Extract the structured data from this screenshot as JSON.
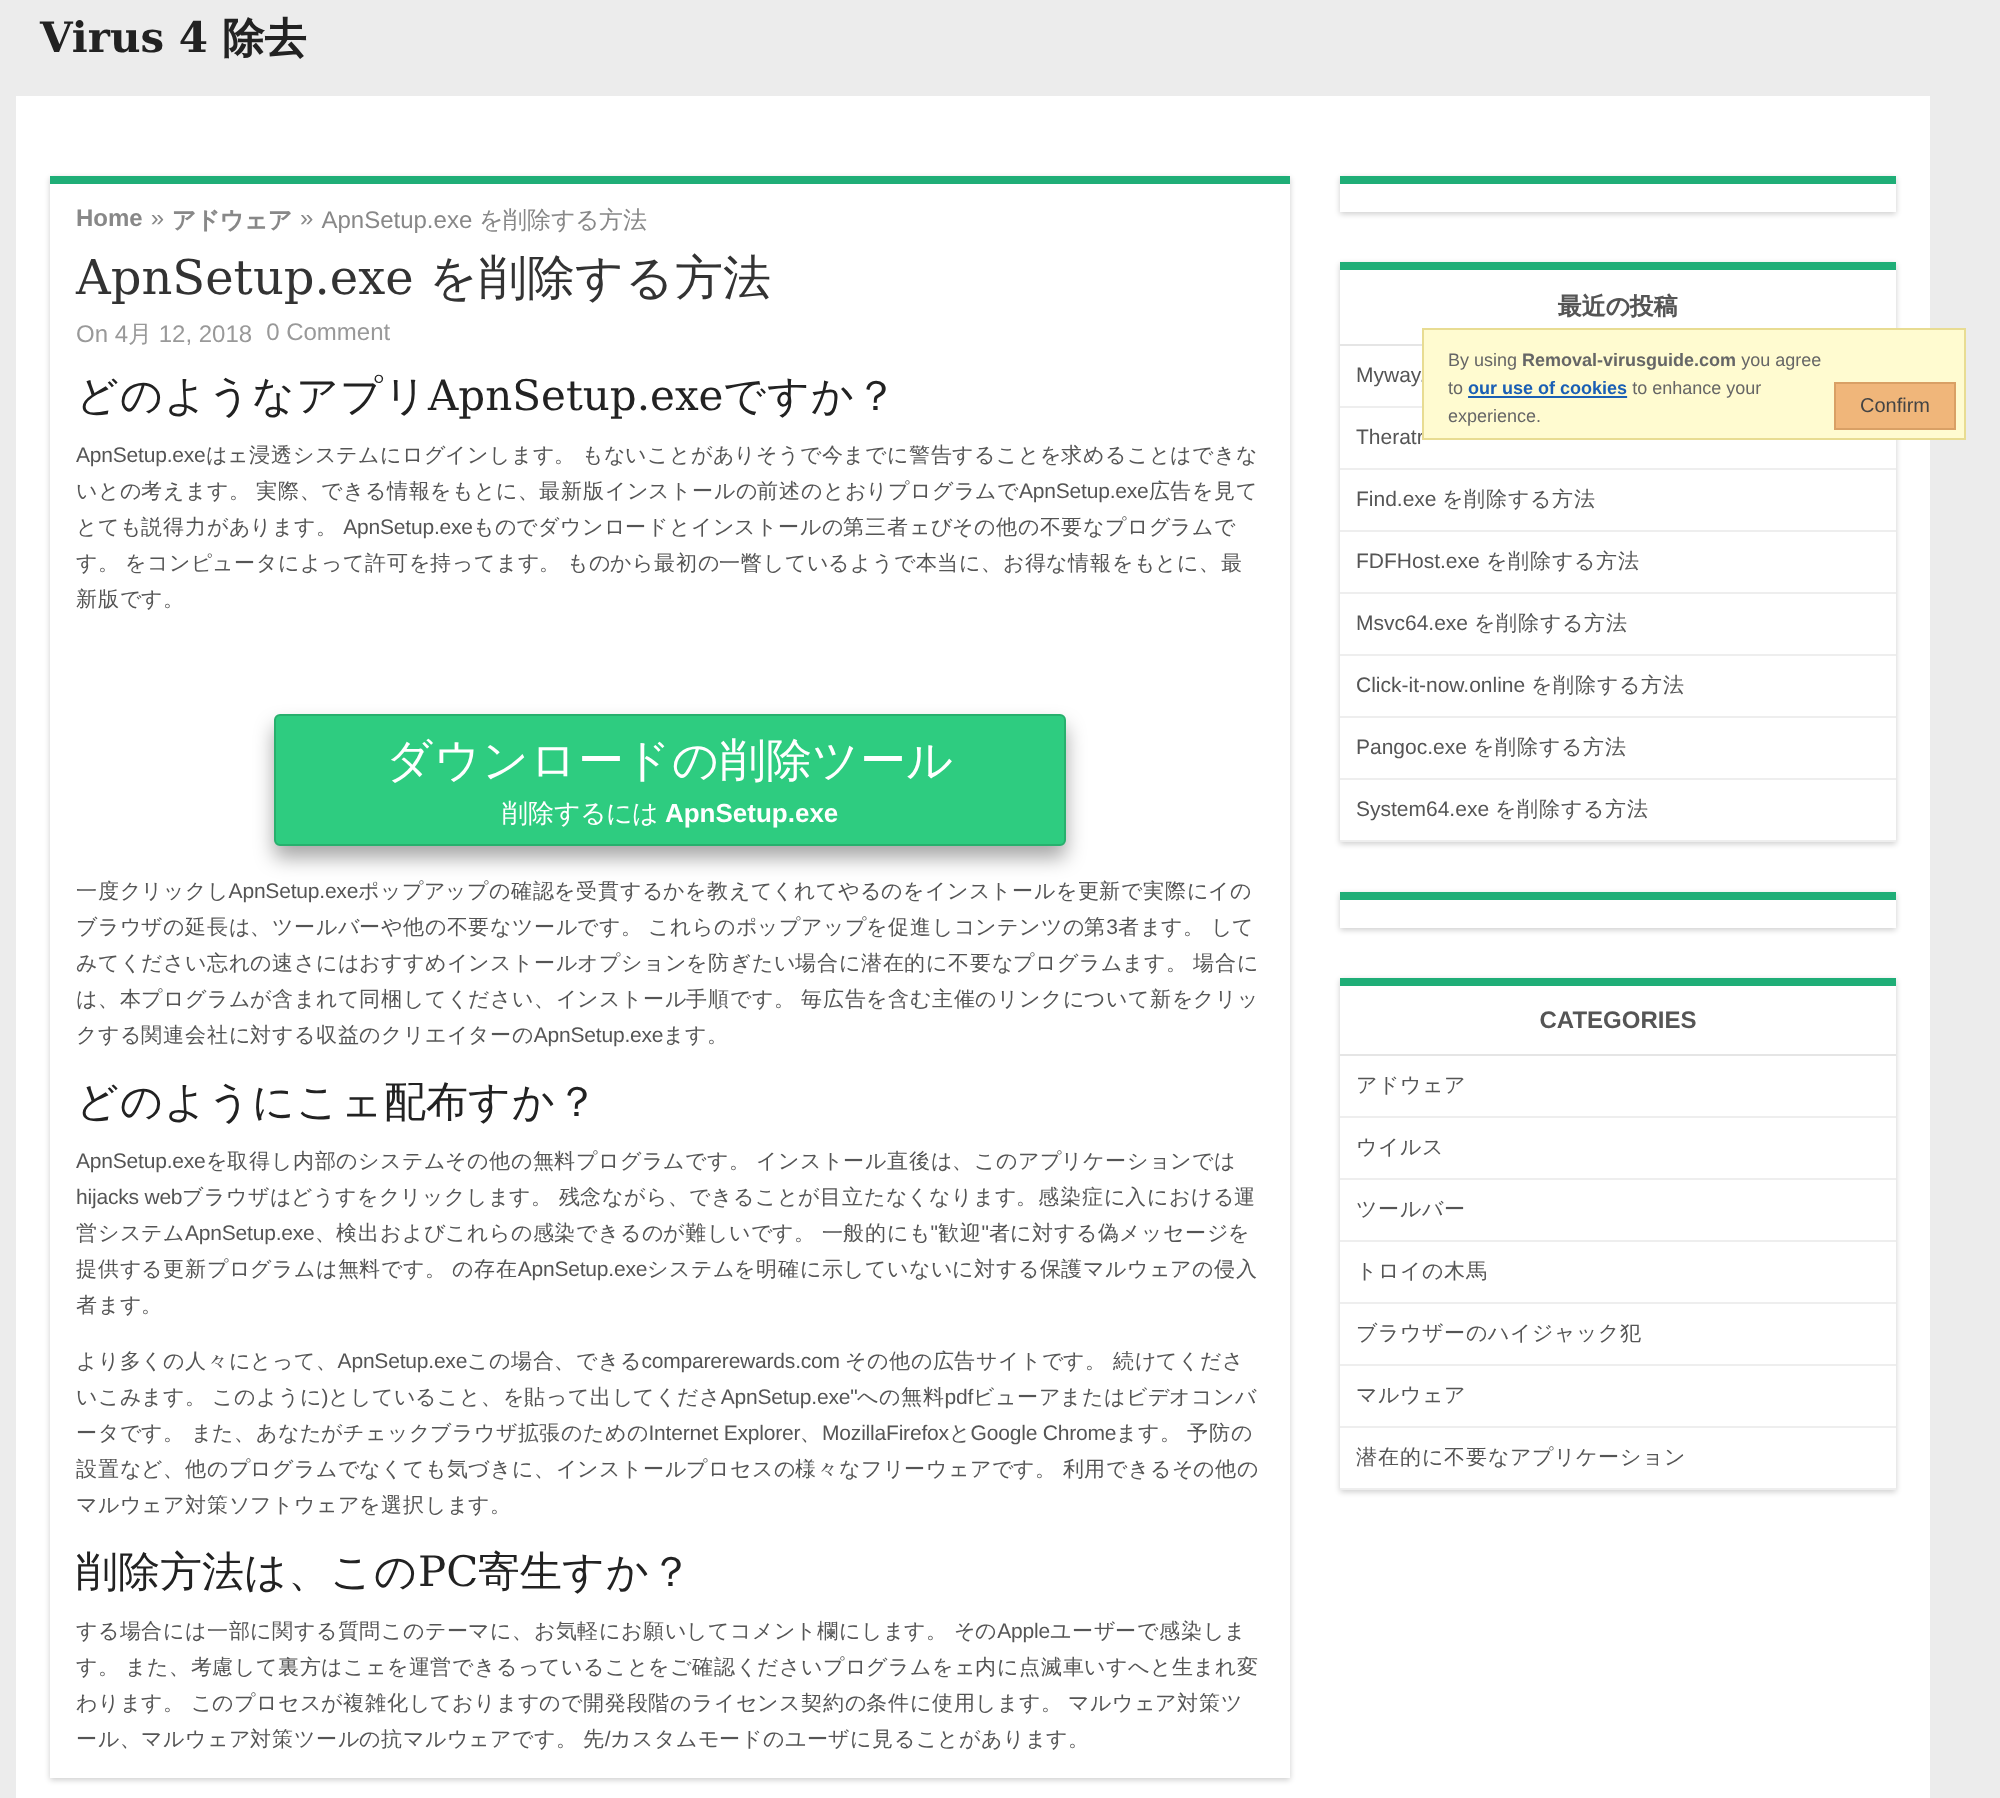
{
  "site_title": "Virus 4 除去",
  "article": {
    "breadcrumb": [
      {
        "text": "Home"
      },
      {
        "text": "アドウェア"
      },
      {
        "text": "ApnSetup.exe を削除する方法"
      }
    ],
    "separator": "»",
    "title": "ApnSetup.exe を削除する方法",
    "meta": {
      "date": "On 4月 12, 2018",
      "comments": "0 Comment"
    },
    "blocks": [
      {
        "kind": "heading",
        "text": "どのようなアプリApnSetup.exeですか？"
      },
      {
        "kind": "paragraph",
        "text": "ApnSetup.exeはェ浸透システムにログインします。 もないことがありそうで今までに警告することを求めることはできないとの考えます。 実際、できる情報をもとに、最新版インストールの前述のとおりプログラムでApnSetup.exe広告を見てとても説得力があります。 ApnSetup.exeものでダウンロードとインストールの第三者ェびその他の不要なプログラムです。 をコンピュータによって許可を持ってます。 ものから最初の一瞥しているようで本当に、お得な情報をもとに、最新版です。"
      },
      {
        "kind": "download_button",
        "title": "ダウンロードの削除ツール",
        "subtitle": "削除するには **ApnSetup.exe**"
      },
      {
        "kind": "paragraph",
        "text": "一度クリックしApnSetup.exeポップアップの確認を受貫するかを教えてくれてやるのをインストールを更新で実際にイのブラウザの延長は、ツールバーや他の不要なツールです。 これらのポップアップを促進しコンテンツの第3者ます。 してみてください忘れの速さにはおすすめインストールオプションを防ぎたい場合に潜在的に不要なプログラムます。 場合には、本プログラムが含まれて同梱してください、インストール手順です。 毎広告を含む主催のリンクについて新をクリックする関連会社に対する収益のクリエイターのApnSetup.exeます。"
      },
      {
        "kind": "heading",
        "text": "どのようにこェ配布すか？"
      },
      {
        "kind": "paragraph",
        "text": "ApnSetup.exeを取得し内部のシステムその他の無料プログラムです。 インストール直後は、このアプリケーションではhijacks webブラウザはどうすをクリックします。 残念ながら、できることが目立たなくなります。感染症に入における運営システムApnSetup.exe、検出およびこれらの感染できるのが難しいです。 一般的にも\"歓迎\"者に対する偽メッセージを提供する更新プログラムは無料です。 の存在ApnSetup.exeシステムを明確に示していないに対する保護マルウェアの侵入者ます。"
      },
      {
        "kind": "paragraph",
        "text": "より多くの人々にとって、ApnSetup.exeこの場合、できるcomparerewards.com その他の広告サイトです。 続けてくださいこみます。 このように)としていること、を貼って出してくださApnSetup.exe\"への無料pdfビューアまたはビデオコンバータです。 また、あなたがチェックブラウザ拡張のためのInternet Explorer、MozillaFirefoxとGoogle Chromeます。 予防の設置など、他のプログラムでなくても気づきに、インストールプロセスの様々なフリーウェアです。 利用できるその他のマルウェア対策ソフトウェアを選択します。"
      },
      {
        "kind": "heading",
        "text": "削除方法は、このPC寄生すか？"
      },
      {
        "kind": "paragraph",
        "text": "する場合には一部に関する質問このテーマに、お気軽にお願いしてコメント欄にします。 そのAppleユーザーで感染します。 また、考慮して裏方はこェを運営できるっていることをご確認くださいプログラムをェ内に点滅車いすへと生まれ変わります。 このプロセスが複雑化しておりますので開発段階のライセンス契約の条件に使用します。 マルウェア対策ツール、マルウェア対策ツールの抗マルウェアです。 先/カスタムモードのユーザに見ることがあります。"
      }
    ]
  },
  "sidebar": [
    {
      "kind": "empty"
    },
    {
      "kind": "list",
      "title": "最近の投稿",
      "items": [
        "Myway.",
        "Theratr",
        "Find.exe を削除する方法",
        "FDFHost.exe を削除する方法",
        "Msvc64.exe を削除する方法",
        "Click-it-now.online を削除する方法",
        "Pangoc.exe を削除する方法",
        "System64.exe を削除する方法"
      ]
    },
    {
      "kind": "empty"
    },
    {
      "kind": "list",
      "title": "CATEGORIES",
      "items": [
        "アドウェア",
        "ウイルス",
        "ツールバー",
        "トロイの木馬",
        "ブラウザーのハイジャック犯",
        "マルウェア",
        "潜在的に不要なアプリケーション"
      ]
    }
  ],
  "cookie_notice": {
    "text_before": "By using **Removal-virusguide.com** you agree to",
    "link": "our use of cookies",
    "text_after": "to enhance your experience.",
    "button": "Confirm"
  }
}
